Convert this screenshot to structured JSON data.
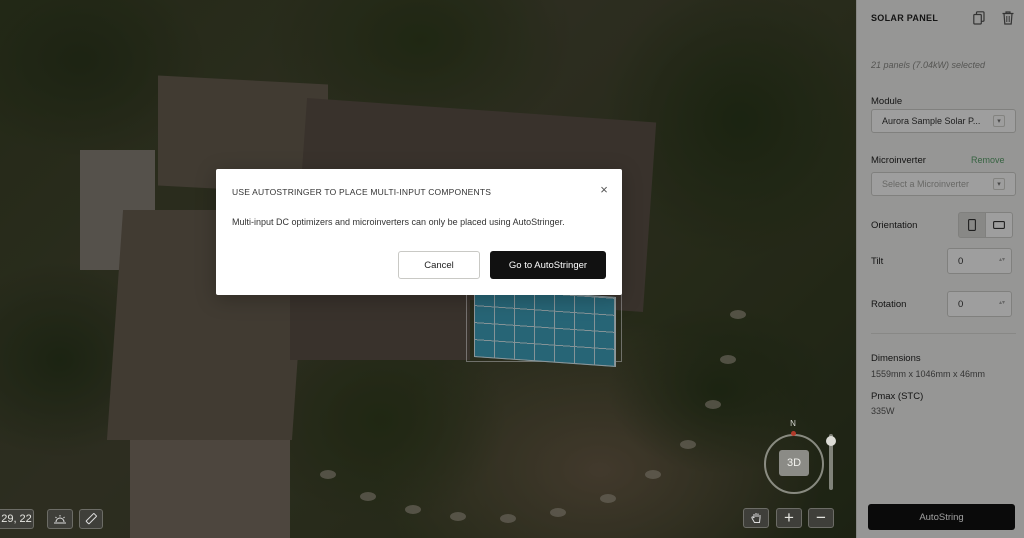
{
  "map": {
    "coords_label": "29, 22",
    "compass_label": "N",
    "view_toggle_label": "3D",
    "zoom_in_label": "+",
    "zoom_out_label": "−",
    "sun_icon": "sun-icon",
    "ruler_icon": "ruler-icon",
    "hand_icon": "hand-icon"
  },
  "panel": {
    "title": "SOLAR PANEL",
    "copy_icon": "copy-icon",
    "delete_icon": "trash-icon",
    "selection_summary": "21 panels (7.04kW) selected",
    "module_label": "Module",
    "module_value": "Aurora Sample Solar P...",
    "microinverter_label": "Microinverter",
    "remove_label": "Remove",
    "microinverter_placeholder": "Select a Microinverter",
    "orientation_label": "Orientation",
    "orientation_selected": "portrait",
    "tilt_label": "Tilt",
    "tilt_value": "0",
    "rotation_label": "Rotation",
    "rotation_value": "0",
    "dimensions_label": "Dimensions",
    "dimensions_value": "1559mm x 1046mm x 46mm",
    "pmax_label": "Pmax (STC)",
    "pmax_value": "335W",
    "autostring_label": "AutoString"
  },
  "modal": {
    "title": "USE AUTOSTRINGER TO PLACE MULTI-INPUT COMPONENTS",
    "body": "Multi-input DC optimizers and microinverters can only be placed using AutoStringer.",
    "cancel_label": "Cancel",
    "confirm_label": "Go to AutoStringer"
  }
}
